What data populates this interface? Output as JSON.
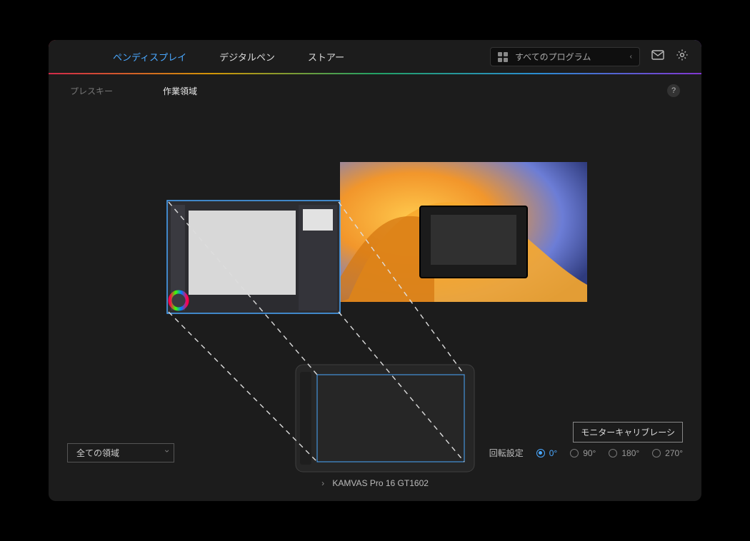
{
  "topnav": {
    "pen_display": "ペンディスプレイ",
    "digital_pen": "デジタルペン",
    "store": "ストアー"
  },
  "program_selector": {
    "label": "すべてのプログラム"
  },
  "subnav": {
    "press_key": "プレスキー",
    "work_area": "作業領域"
  },
  "help": "?",
  "area_select": {
    "value": "全ての領域"
  },
  "calibration_button": "モニターキャリブレーシ",
  "rotate": {
    "label": "回転設定",
    "options": {
      "r0": "0°",
      "r90": "90°",
      "r180": "180°",
      "r270": "270°"
    },
    "selected": "r0"
  },
  "device": {
    "name": "KAMVAS Pro 16 GT1602"
  }
}
